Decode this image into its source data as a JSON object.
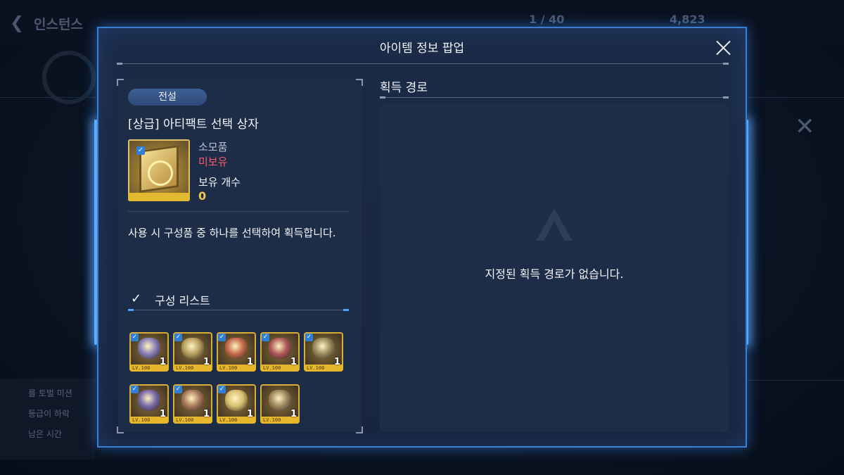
{
  "background": {
    "title": "인스턴스",
    "stat_1": "1 / 40",
    "stat_2": "4,823",
    "panel_lines": [
      "를 토벌 미션",
      "등급이 하락",
      "남은 시간"
    ]
  },
  "popup": {
    "title": "아이템 정보 팝업"
  },
  "item": {
    "grade": "전설",
    "name": "[상급] 아티팩트 선택 상자",
    "type": "소모품",
    "owned_status": "미보유",
    "count_label": "보유 개수",
    "count_value": "0",
    "description": "사용 시 구성품 중 하나를 선택하여 획득합니다."
  },
  "components": {
    "label": "구성 리스트",
    "slots": [
      {
        "lv": "LV.100",
        "qty": "1",
        "color": "#8a7fb8"
      },
      {
        "lv": "LV.100",
        "qty": "1",
        "color": "#b8a060"
      },
      {
        "lv": "LV.100",
        "qty": "1",
        "color": "#c46a4a"
      },
      {
        "lv": "LV.100",
        "qty": "1",
        "color": "#b05a5a"
      },
      {
        "lv": "LV.100",
        "qty": "1",
        "color": "#9a8a5a"
      },
      {
        "lv": "LV.100",
        "qty": "1",
        "color": "#7a6aa8"
      },
      {
        "lv": "LV.100",
        "qty": "1",
        "color": "#a87a5a"
      },
      {
        "lv": "LV.100",
        "qty": "1",
        "color": "#d8c070"
      },
      {
        "lv": "LV.100",
        "qty": "1",
        "color": "#a08a60"
      }
    ]
  },
  "acquisition": {
    "title": "획득 경로",
    "empty_message": "지정된 획득 경로가 없습니다."
  }
}
